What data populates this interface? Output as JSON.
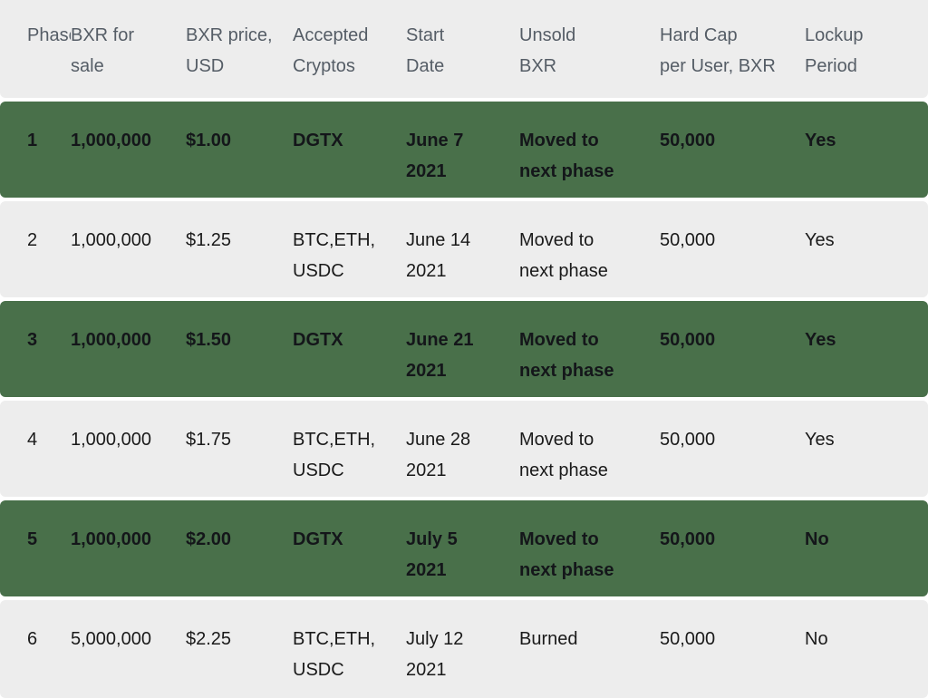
{
  "table": {
    "columns": [
      "Phase",
      "BXR for\nsale",
      "BXR price,\nUSD",
      "Accepted\nCryptos",
      "Start\nDate",
      "Unsold\nBXR",
      "Hard Cap\nper User, BXR",
      "Lockup\nPeriod"
    ],
    "rows": [
      {
        "style": "green",
        "phase": "1",
        "bxr_for_sale": "1,000,000",
        "bxr_price_usd": "$1.00",
        "accepted_cryptos": "DGTX",
        "start_date": "June 7\n2021",
        "unsold_bxr": "Moved to\nnext phase",
        "hard_cap_per_user": "50,000",
        "lockup_period": "Yes"
      },
      {
        "style": "light",
        "phase": "2",
        "bxr_for_sale": "1,000,000",
        "bxr_price_usd": "$1.25",
        "accepted_cryptos": "BTC,ETH,\nUSDC",
        "start_date": "June 14\n2021",
        "unsold_bxr": "Moved to\nnext phase",
        "hard_cap_per_user": "50,000",
        "lockup_period": "Yes"
      },
      {
        "style": "green",
        "phase": "3",
        "bxr_for_sale": "1,000,000",
        "bxr_price_usd": "$1.50",
        "accepted_cryptos": "DGTX",
        "start_date": "June 21\n2021",
        "unsold_bxr": "Moved to\nnext phase",
        "hard_cap_per_user": "50,000",
        "lockup_period": "Yes"
      },
      {
        "style": "light",
        "phase": "4",
        "bxr_for_sale": "1,000,000",
        "bxr_price_usd": "$1.75",
        "accepted_cryptos": "BTC,ETH,\nUSDC",
        "start_date": "June 28\n2021",
        "unsold_bxr": "Moved to\nnext phase",
        "hard_cap_per_user": "50,000",
        "lockup_period": "Yes"
      },
      {
        "style": "green",
        "phase": "5",
        "bxr_for_sale": "1,000,000",
        "bxr_price_usd": "$2.00",
        "accepted_cryptos": "DGTX",
        "start_date": "July 5\n2021",
        "unsold_bxr": "Moved to\nnext phase",
        "hard_cap_per_user": "50,000",
        "lockup_period": "No"
      },
      {
        "style": "light",
        "phase": "6",
        "bxr_for_sale": "5,000,000",
        "bxr_price_usd": "$2.25",
        "accepted_cryptos": "BTC,ETH,\nUSDC",
        "start_date": "July 12\n2021",
        "unsold_bxr": "Burned",
        "hard_cap_per_user": "50,000",
        "lockup_period": "No"
      }
    ]
  },
  "colors": {
    "header_background": "#ededed",
    "header_text": "#555d66",
    "row_green_background": "#49704a",
    "row_green_text": "#14161a",
    "row_light_background": "#ededed",
    "row_light_text": "#1a1a1a",
    "page_background": "#ffffff"
  }
}
